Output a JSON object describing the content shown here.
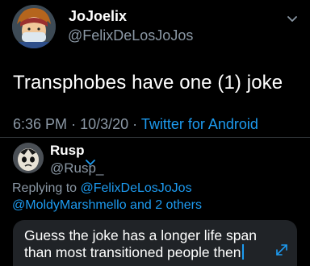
{
  "tweet": {
    "display_name": "JoJoelix",
    "handle": "@FelixDeLosJoJos",
    "text": "Transphobes have one (1) joke",
    "time": "6:36 PM",
    "date": "10/3/20",
    "separator": "·",
    "source": "Twitter for Android"
  },
  "reply_composer": {
    "display_name": "Rusp",
    "handle": "@Rusp_",
    "replying_prefix": "Replying to",
    "replying_to_primary": "@FelixDeLosJoJos",
    "replying_to_secondary": "@MoldyMarshmello and 2 others",
    "draft_text": "Guess the joke has a longer life span than most transitioned people then"
  },
  "icons": {
    "tweet_menu": "chevron-down-icon",
    "account_switch": "chevron-down-icon",
    "expand": "expand-icon"
  },
  "colors": {
    "background": "#000000",
    "primary_text": "#ffffff",
    "secondary_text": "#8b98a5",
    "link": "#1d9bf0",
    "composer_background": "#202327"
  }
}
